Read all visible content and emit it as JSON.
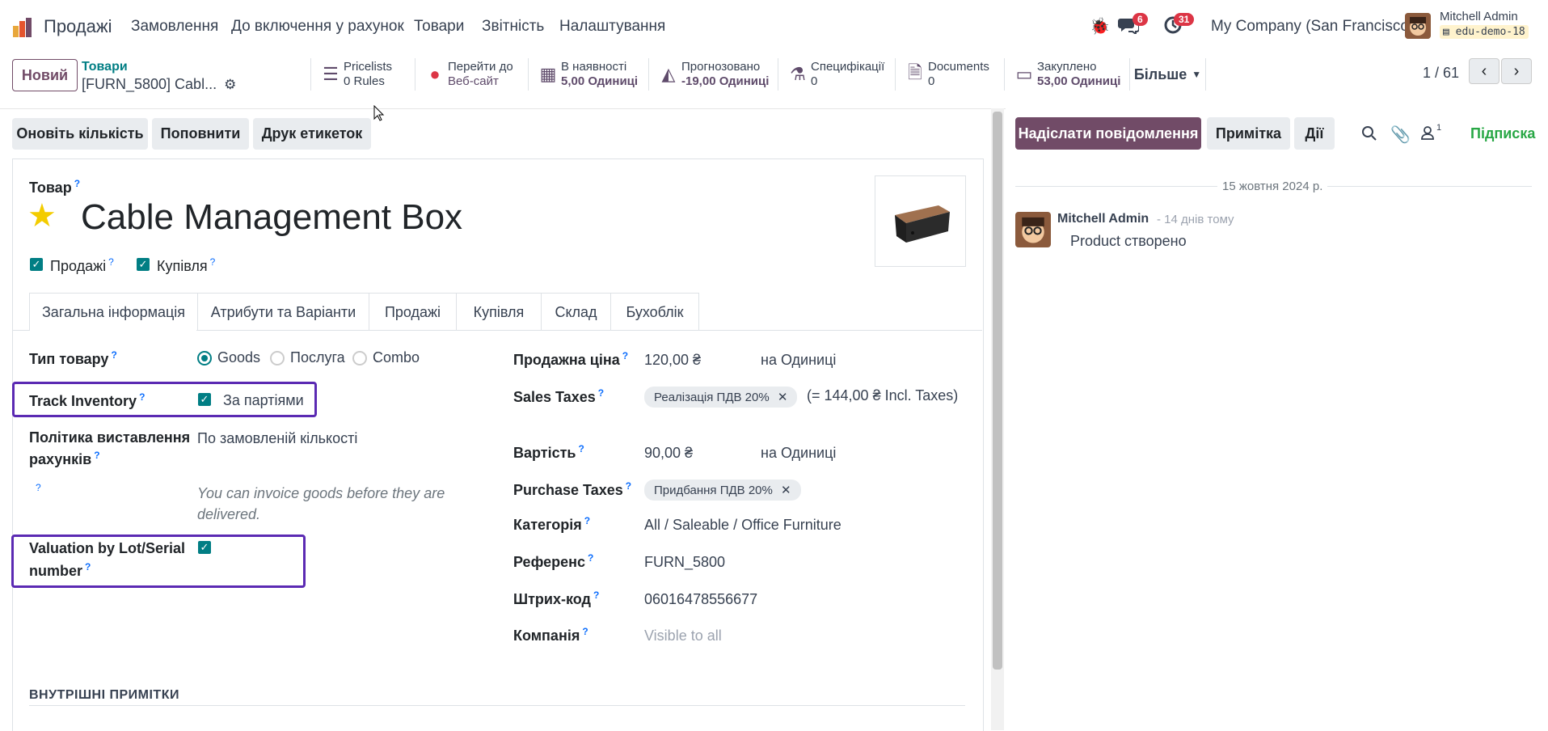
{
  "topnav": {
    "app_name": "Продажі",
    "menu": [
      "Замовлення",
      "До включення у рахунок",
      "Товари",
      "Звітність",
      "Налаштування"
    ],
    "chat_badge": "6",
    "activity_badge": "31",
    "company": "My Company (San Francisco)",
    "user_name": "Mitchell Admin",
    "db_name": "edu-demo-18"
  },
  "control": {
    "new_button": "Новий",
    "breadcrumb_parent": "Товари",
    "breadcrumb_current": "[FURN_5800] Cabl...",
    "pager": "1 / 61",
    "more_button": "Більше"
  },
  "smart_buttons": [
    {
      "icon": "list-icon",
      "line1": "Pricelists",
      "line2": "0 Rules"
    },
    {
      "icon": "globe-icon",
      "line1": "Перейти до",
      "line2": "Веб-сайт"
    },
    {
      "icon": "cubes-icon",
      "line1": "В наявності",
      "line2": "5,00 Одиниці"
    },
    {
      "icon": "area-chart-icon",
      "line1": "Прогнозовано",
      "line2": "-19,00 Одиниці"
    },
    {
      "icon": "flask-icon",
      "line1": "Специфікації",
      "line2": "0"
    },
    {
      "icon": "document-icon",
      "line1": "Documents",
      "line2": "0"
    },
    {
      "icon": "credit-card-icon",
      "line1": "Закуплено",
      "line2": "53,00 Одиниці"
    }
  ],
  "actions": {
    "update_qty": "Оновіть кількість",
    "replenish": "Поповнити",
    "print_labels": "Друк етикеток"
  },
  "product": {
    "section_label": "Товар",
    "name": "Cable Management Box",
    "sales_checkbox": "Продажі",
    "purchase_checkbox": "Купівля"
  },
  "tabs": [
    "Загальна інформація",
    "Атрибути та Варіанти",
    "Продажі",
    "Купівля",
    "Склад",
    "Бухоблік"
  ],
  "left_fields": {
    "product_type_label": "Тип товару",
    "type_options": [
      "Goods",
      "Послуга",
      "Combo"
    ],
    "track_inventory_label": "Track Inventory",
    "track_inventory_value": "За партіями",
    "invoice_policy_label_1": "Політика виставлення",
    "invoice_policy_label_2": "рахунків",
    "invoice_policy_value": "По замовленій кількості",
    "invoice_hint_1": "You can invoice goods before they are",
    "invoice_hint_2": "delivered.",
    "valuation_label_1": "Valuation by Lot/Serial",
    "valuation_label_2": "number"
  },
  "right_fields": {
    "sale_price_label": "Продажна ціна",
    "sale_price": "120,00 ₴",
    "sale_uom": "на Одиниці",
    "sales_taxes_label": "Sales Taxes",
    "sales_tax_tag": "Реалізація ПДВ 20%",
    "incl_taxes": "(= 144,00 ₴ Incl. Taxes)",
    "cost_label": "Вартість",
    "cost": "90,00 ₴",
    "cost_uom": "на Одиниці",
    "purchase_taxes_label": "Purchase Taxes",
    "purchase_tax_tag": "Придбання ПДВ 20%",
    "category_label": "Категорія",
    "category": "All / Saleable / Office Furniture",
    "reference_label": "Референс",
    "reference": "FURN_5800",
    "barcode_label": "Штрих-код",
    "barcode": "06016478556677",
    "company_label": "Компанія",
    "company_placeholder": "Visible to all"
  },
  "internal_notes": "ВНУТРІШНІ ПРИМІТКИ",
  "chatter": {
    "send_message": "Надіслати повідомлення",
    "note": "Примітка",
    "activities": "Дії",
    "followers_count": "1",
    "follow": "Підписка",
    "date_separator": "15 жовтня 2024 р.",
    "author": "Mitchell Admin",
    "time_ago": "- 14 днів тому",
    "message": "Product створено"
  },
  "colors": {
    "brand": "#714b67",
    "teal": "#017e84",
    "highlight": "#5b2ab3",
    "follow_green": "#28a745"
  }
}
